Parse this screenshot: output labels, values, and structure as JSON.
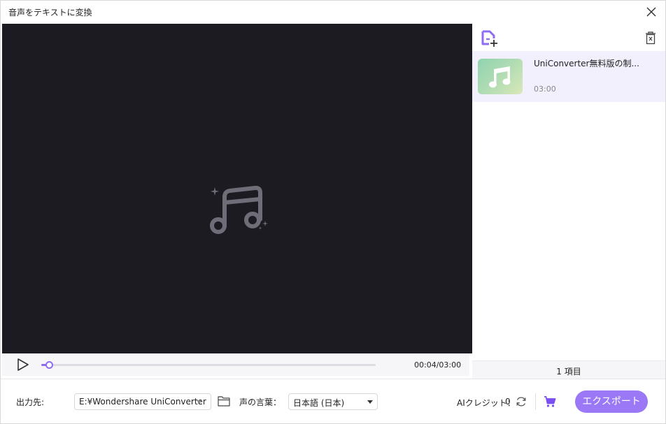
{
  "window": {
    "title": "音声をテキストに変換"
  },
  "player": {
    "time": "00:04/03:00",
    "progress": 0.022
  },
  "files": [
    {
      "name": "UniConverter無料版の制...",
      "duration": "03:00"
    }
  ],
  "sidebar": {
    "count": "1 項目"
  },
  "bottom": {
    "output_label": "出力先:",
    "output_path": "E:¥Wondershare UniConverter",
    "language_label": "声の言葉：",
    "language_value": "日本語 (日本)",
    "credit_label": "AIクレジット：",
    "credit_value": "0",
    "export_label": "エクスポート"
  },
  "icons": {
    "close": "close-icon",
    "music_note": "music-note-icon",
    "add_file": "add-file-icon",
    "trash": "trash-icon",
    "play": "play-icon",
    "folder": "folder-icon",
    "refresh": "refresh-icon",
    "cart": "cart-icon"
  },
  "colors": {
    "accent": "#8e6cf3",
    "export_button": "#9b79f6",
    "preview_bg": "#1c1b22",
    "selected_item": "#f3f0fe"
  }
}
